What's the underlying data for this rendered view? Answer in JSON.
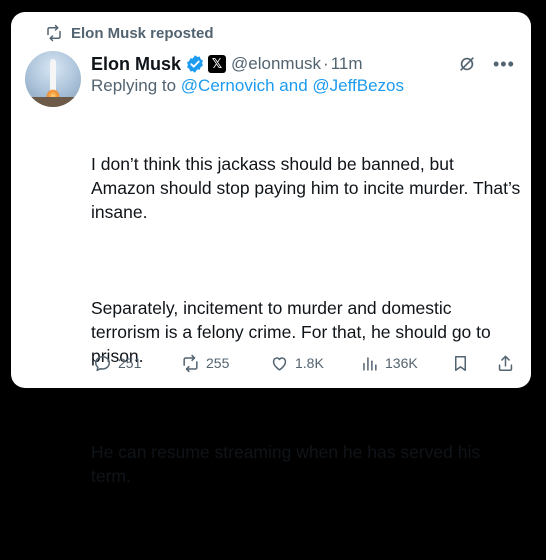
{
  "repost_banner": {
    "icon": "repost-icon",
    "text": "Elon Musk reposted"
  },
  "author": {
    "name": "Elon Musk",
    "verified_icon": "verified-badge-icon",
    "affiliation_badge": "𝕏",
    "handle": "@elonmusk",
    "separator": "·",
    "time": "11m",
    "avatar": "rocket-launch-avatar"
  },
  "reply_to": {
    "prefix": "Replying to ",
    "mentions": "@Cernovich and @JeffBezos"
  },
  "tweet": {
    "paragraphs": [
      "I don’t think this jackass should be banned, but Amazon should stop paying him to incite murder. That’s insane.",
      "Separately, incitement to murder and domestic terrorism is a felony crime. For that, he should go to prison.",
      "He can resume streaming when he has served his term."
    ]
  },
  "actions": {
    "reply_count": "251",
    "repost_count": "255",
    "like_count": "1.8K",
    "view_count": "136K"
  },
  "colors": {
    "link": "#1d9bf0",
    "muted": "#536471",
    "text": "#0f1419",
    "background": "#000000",
    "card": "#ffffff"
  }
}
